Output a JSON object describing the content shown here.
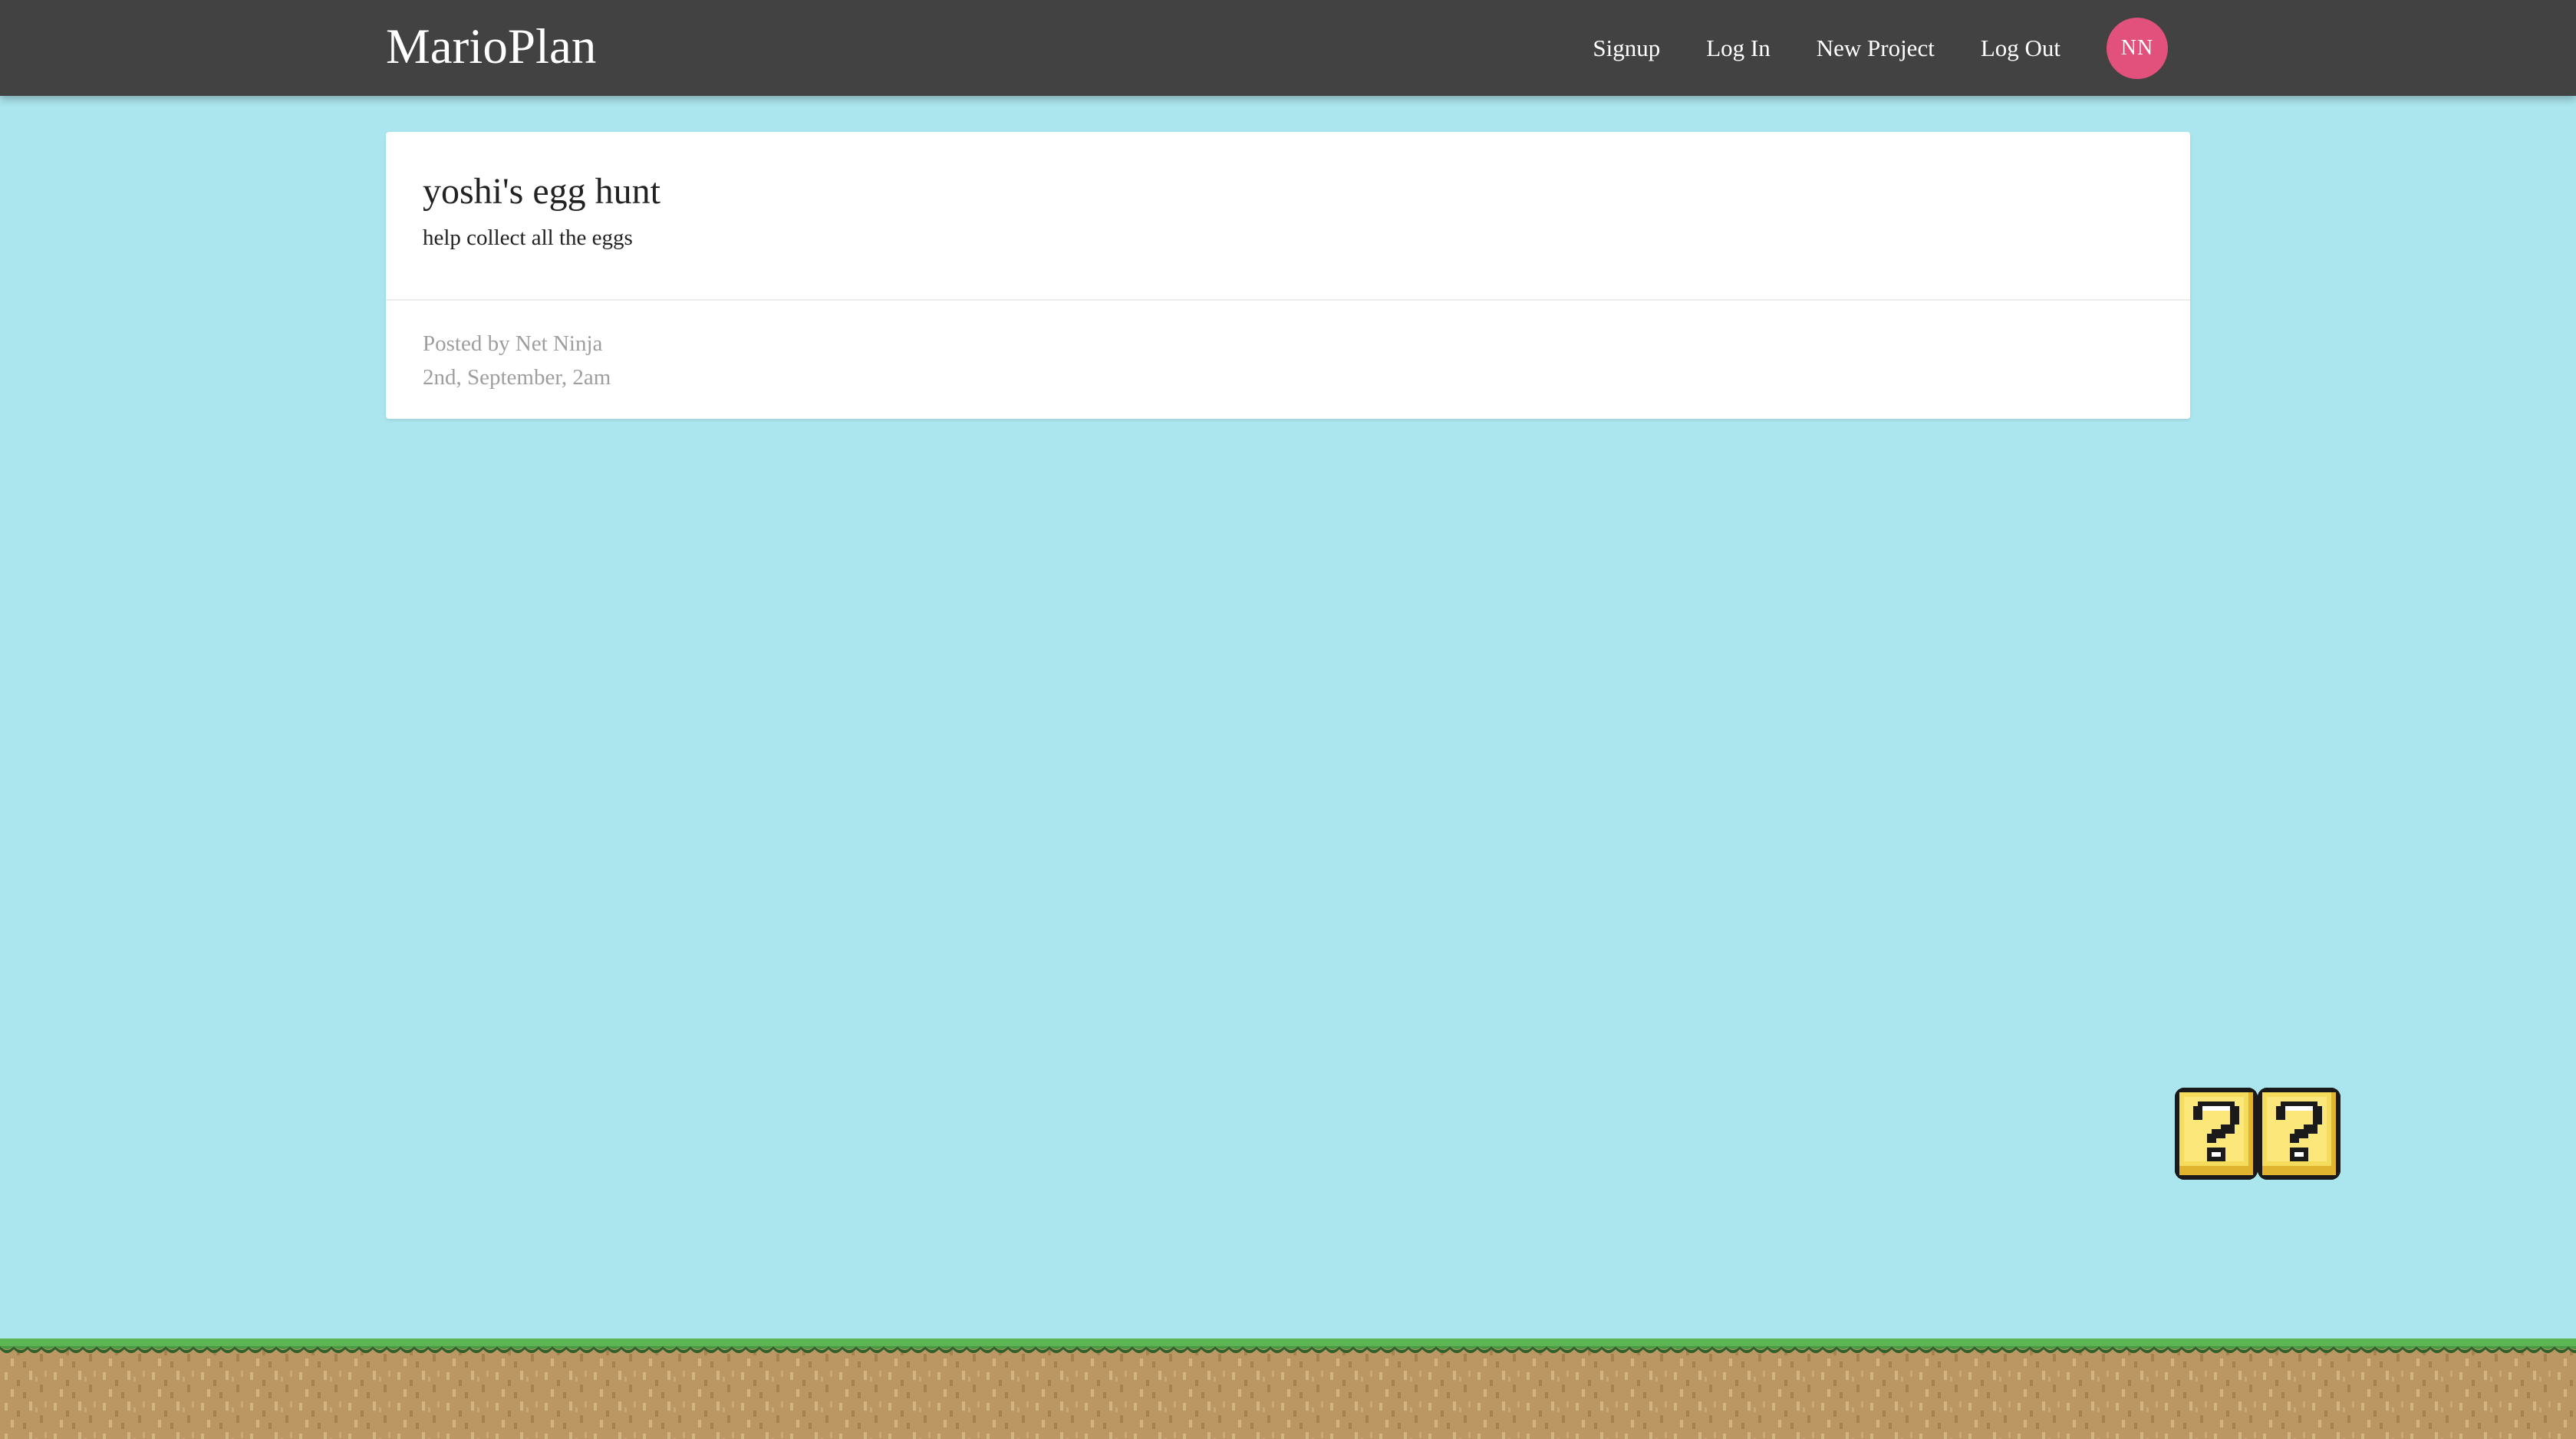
{
  "navbar": {
    "brand": "MarioPlan",
    "links": {
      "signup": "Signup",
      "login": "Log In",
      "new_project": "New Project",
      "logout": "Log Out"
    },
    "avatar_initials": "NN"
  },
  "project": {
    "title": "yoshi's egg hunt",
    "content": "help collect all the eggs",
    "posted_by": "Posted by Net Ninja",
    "date": "2nd, September, 2am"
  },
  "scene": {
    "block_icon": "question-block-icon",
    "ground": "grass-dirt-ground"
  },
  "colors": {
    "sky": "#abe5ee",
    "navbar": "#424242",
    "avatar": "#e2507c",
    "grass": "#5ab552",
    "dirt": "#bb9863"
  }
}
